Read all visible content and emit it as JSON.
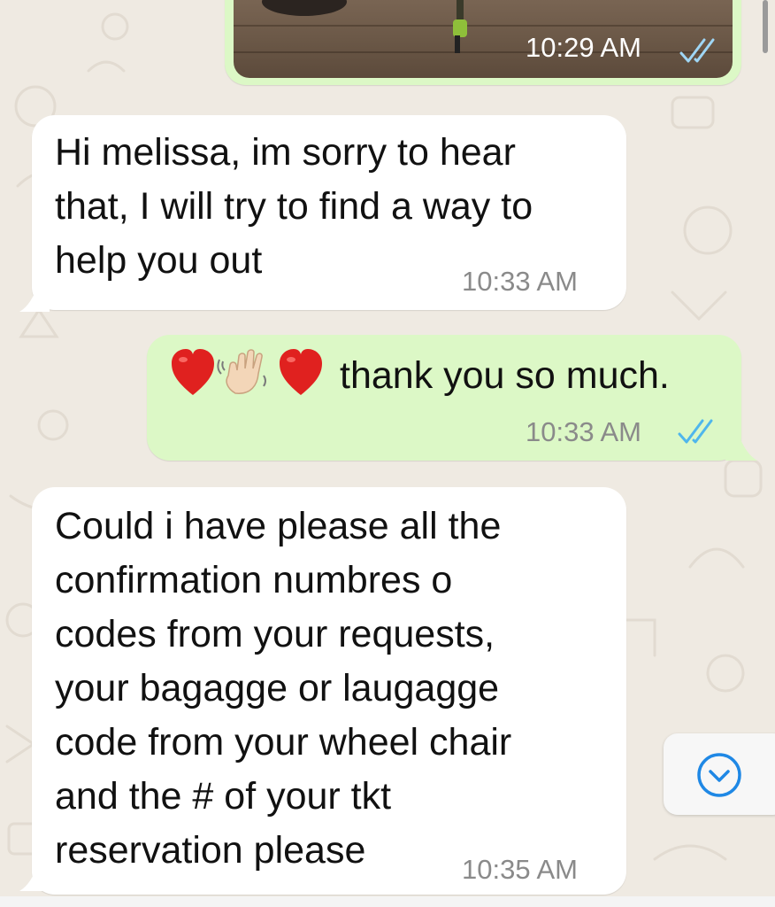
{
  "messages": [
    {
      "direction": "outgoing",
      "type": "photo",
      "time": "10:29 AM",
      "read": true
    },
    {
      "direction": "incoming",
      "text": "Hi melissa, im sorry to hear\nthat, I will try to find a way to\nhelp you out",
      "time": "10:33 AM"
    },
    {
      "direction": "outgoing",
      "emojis": [
        "red-heart",
        "waving-hand",
        "red-heart"
      ],
      "text": "thank you so much.",
      "time": "10:33 AM",
      "read": true
    },
    {
      "direction": "incoming",
      "text": "Could i have please all the\nconfirmation numbres o\ncodes from your requests,\nyour bagagge or laugagge\ncode from your wheel chair\nand the #  of your tkt\nreservation please",
      "time": "10:35 AM"
    }
  ],
  "scroll_button": {
    "icon": "chevron-down-circle-icon"
  },
  "colors": {
    "wallpaper": "#efeae2",
    "incoming_bubble": "#ffffff",
    "outgoing_bubble": "#dcf8c6",
    "read_ticks": "#4fb6ec",
    "timestamp": "#8a8a8a",
    "scroll_icon": "#1f88e5"
  }
}
